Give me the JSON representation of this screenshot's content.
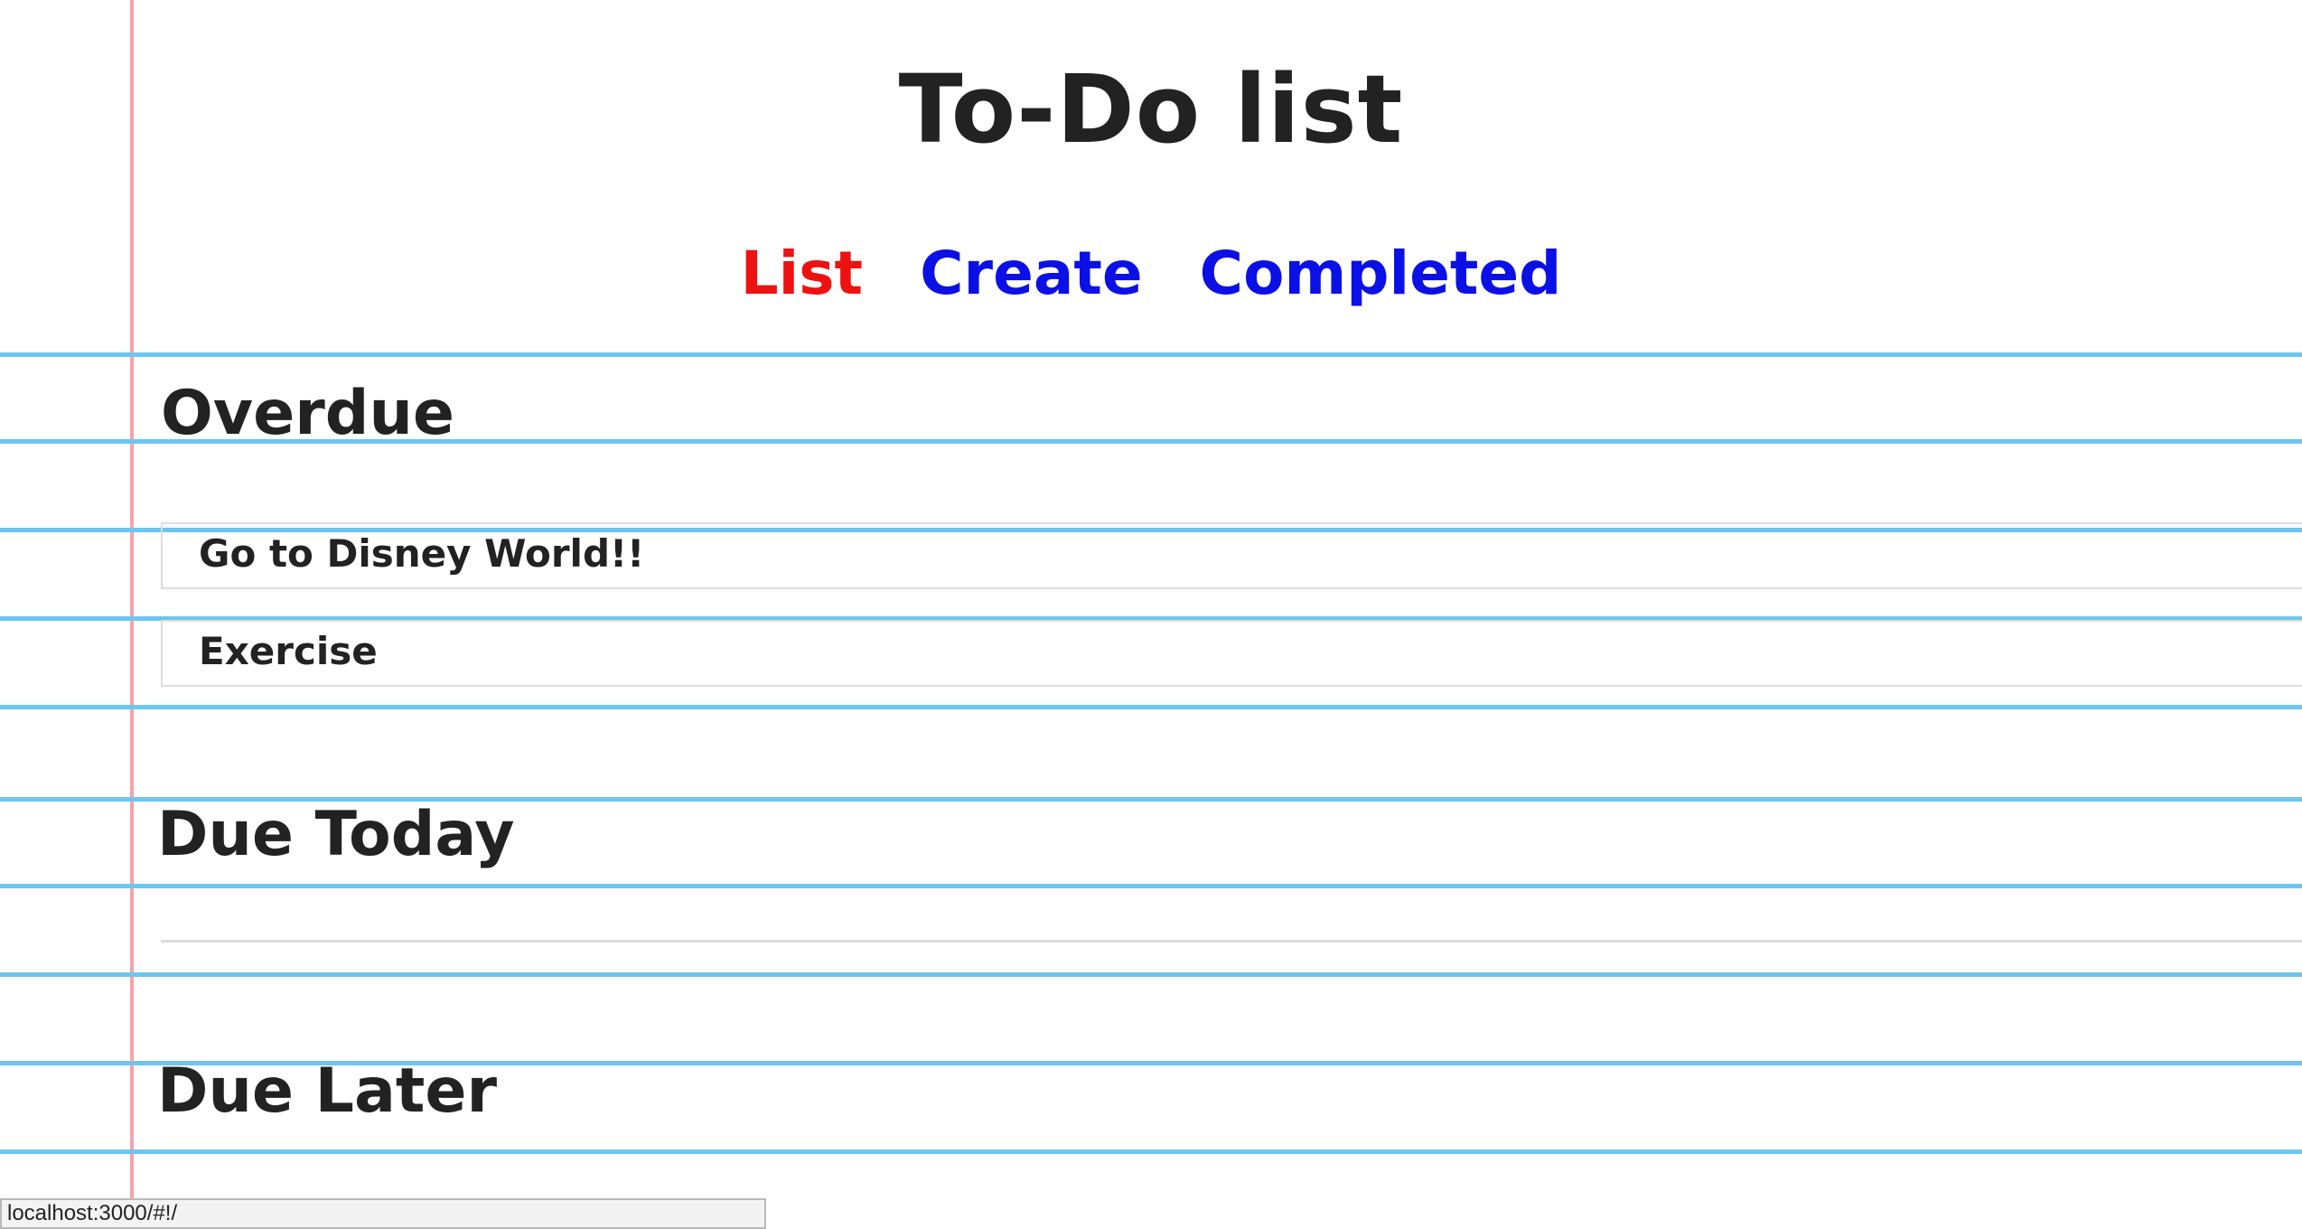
{
  "header": {
    "title": "To-Do list"
  },
  "nav": {
    "items": [
      {
        "label": "List",
        "active": true
      },
      {
        "label": "Create",
        "active": false
      },
      {
        "label": "Completed",
        "active": false
      }
    ],
    "active_color": "#ee1111",
    "link_color": "#0b10e6"
  },
  "sections": {
    "overdue": {
      "heading": "Overdue",
      "tasks": [
        "Go to Disney World!!",
        "Exercise"
      ]
    },
    "due_today": {
      "heading": "Due Today",
      "tasks": []
    },
    "due_later": {
      "heading": "Due Later",
      "tasks": []
    }
  },
  "status_bar": {
    "url": "localhost:3000/#!/"
  },
  "colors": {
    "ruled_line": "#6cc6ee",
    "margin_line": "#f5a3a8",
    "text": "#222222"
  }
}
